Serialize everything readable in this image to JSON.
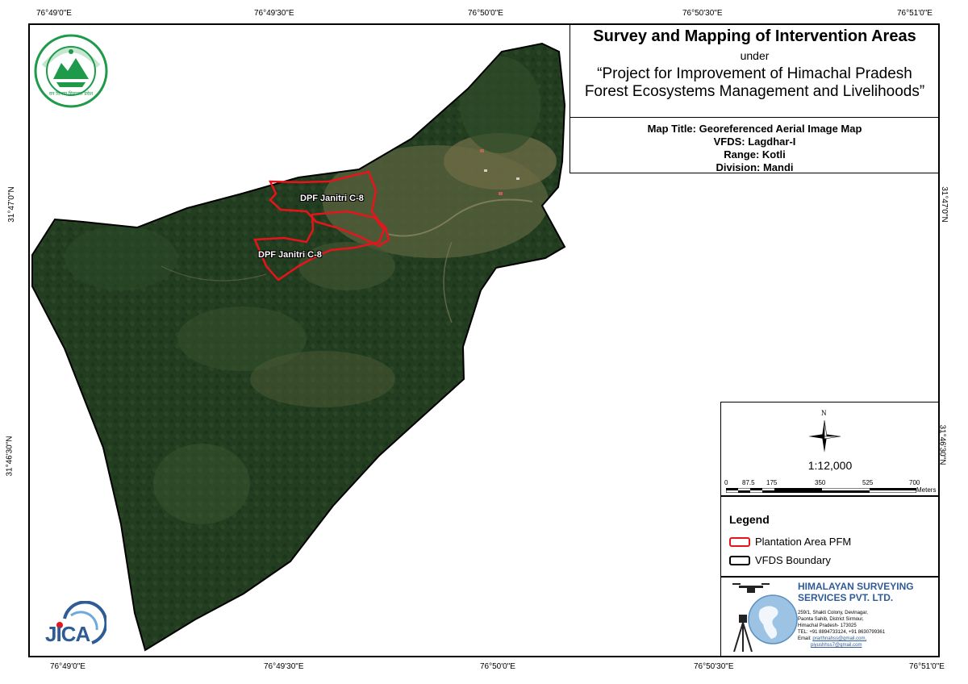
{
  "ticks": {
    "top": [
      "76°49'0\"E",
      "76°49'30\"E",
      "76°50'0\"E",
      "76°50'30\"E",
      "76°51'0\"E"
    ],
    "bottom": [
      "76°49'0\"E",
      "76°49'30\"E",
      "76°50'0\"E",
      "76°50'30\"E",
      "76°51'0\"E"
    ],
    "left": [
      "31°47'0\"N",
      "31°46'30\"N"
    ],
    "right": [
      "31°47'0\"N",
      "31°46'30\"N"
    ]
  },
  "title": {
    "main": "Survey and Mapping of Intervention Areas",
    "under": "under",
    "project_line1": "“Project for Improvement of Himachal Pradesh",
    "project_line2": "Forest Ecosystems Management and Livelihoods”",
    "map_title": "Map Title: Georeferenced Aerial Image Map",
    "vfds": "VFDS: Lagdhar-I",
    "range": "Range: Kotli",
    "division": "Division: Mandi"
  },
  "map_labels": {
    "plot1": "DPF Janitri C-8",
    "plot2": "DPF Janitri C-8"
  },
  "scale": {
    "north": "N",
    "ratio": "1:12,000",
    "bar_labels": [
      "0",
      "87.5",
      "175",
      "350",
      "525",
      "700"
    ],
    "units": "Meters"
  },
  "legend": {
    "heading": "Legend",
    "items": [
      {
        "label": "Plantation Area PFM",
        "color": "#e8141c"
      },
      {
        "label": "VFDS Boundary",
        "color": "#000000"
      }
    ]
  },
  "company": {
    "name_line1": "HIMALAYAN SURVEYING",
    "name_line2": "SERVICES PVT. LTD.",
    "address": [
      "259/1, Shakti Colony, Devinagar,",
      "Paonta Sahib, District Sirmour,",
      "Himachal Pradesh- 173025",
      "TEL: +91 8894733124, +91 8630799361"
    ],
    "email_label": "Email:",
    "email1": "prarthnahss@gmail.com,",
    "email2": "piyushhss7@gmail.com",
    "brand_color": "#2f5b96"
  },
  "logos": {
    "forest_dept_text": "वन विभाग हिमाचल प्रदेश",
    "jica": "JICA"
  },
  "colors": {
    "forest_dark": "#1f3a1c",
    "forest_mid": "#2d4a26",
    "clearing": "#6b6a45",
    "plantation": "#e8141c",
    "logo_green": "#1e9a4a"
  }
}
